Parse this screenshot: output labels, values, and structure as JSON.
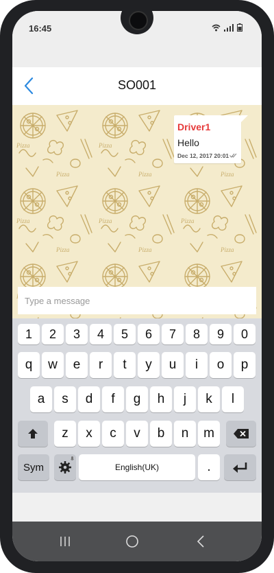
{
  "status_bar": {
    "time": "16:45"
  },
  "header": {
    "title": "SO001"
  },
  "chat": {
    "messages": [
      {
        "sender": "Driver1",
        "text": "Hello",
        "timestamp": "Dec 12, 2017 20:01"
      }
    ],
    "sender_color": "#e63a3a",
    "background_color": "#f4ebcc",
    "pattern_color": "#c8ad6b"
  },
  "composer": {
    "placeholder": "Type a message"
  },
  "keyboard": {
    "number_row": [
      "1",
      "2",
      "3",
      "4",
      "5",
      "6",
      "7",
      "8",
      "9",
      "0"
    ],
    "row1": [
      "q",
      "w",
      "e",
      "r",
      "t",
      "y",
      "u",
      "i",
      "o",
      "p"
    ],
    "row2": [
      "a",
      "s",
      "d",
      "f",
      "g",
      "h",
      "j",
      "k",
      "l"
    ],
    "row3": [
      "z",
      "x",
      "c",
      "v",
      "b",
      "n",
      "m"
    ],
    "sym_label": "Sym",
    "space_label": "English(UK)",
    "period_label": ".",
    "icons": {
      "shift": "shift-arrow-icon",
      "backspace": "backspace-icon",
      "settings": "gear-icon",
      "enter": "enter-icon",
      "mic": "mic-icon"
    }
  },
  "nav_bar": {
    "icons": [
      "recent-apps-icon",
      "home-icon",
      "back-icon"
    ]
  }
}
